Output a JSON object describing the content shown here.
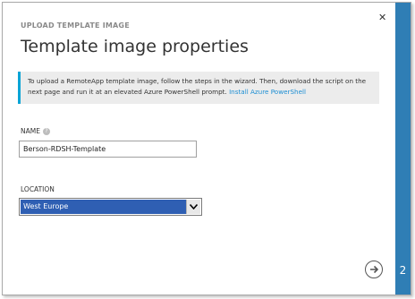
{
  "dialog": {
    "wizard_label": "UPLOAD TEMPLATE IMAGE",
    "close_icon": "close-icon",
    "title": "Template image properties"
  },
  "info": {
    "text": "To upload a RemoteApp template image, follow the steps in the wizard. Then, download the script on the next page and run it at an elevated Azure PowerShell prompt.",
    "link": "Install Azure PowerShell",
    "accent_color": "#0aa4d6"
  },
  "form": {
    "name_label": "NAME",
    "name_help_icon": "help-icon",
    "name_value": "Berson-RDSH-Template",
    "location_label": "LOCATION",
    "location_value": "West Europe"
  },
  "footer": {
    "next_icon": "arrow-right-icon",
    "step": "2",
    "sidebar_color": "#2f7eb5"
  }
}
